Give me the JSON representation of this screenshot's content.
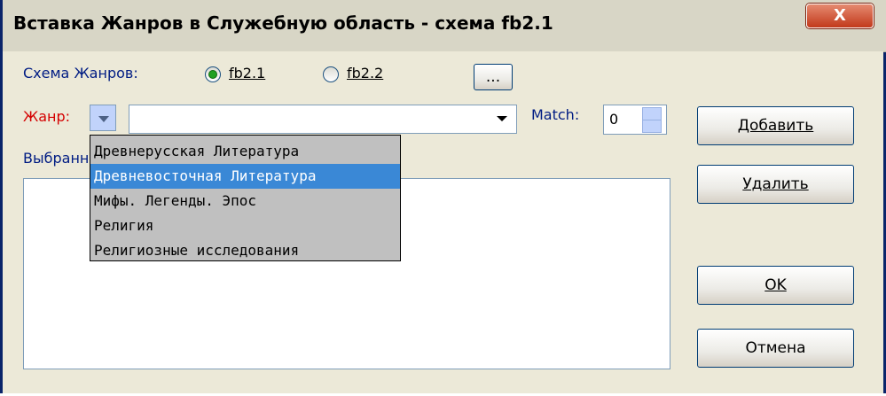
{
  "window": {
    "title": "Вставка Жанров в Служебную область - схема fb2.1",
    "close_label": "X"
  },
  "schema": {
    "label": "Схема Жанров:",
    "options": [
      {
        "label": "fb2.1",
        "checked": true
      },
      {
        "label": "fb2.2",
        "checked": false
      }
    ],
    "browse_label": "..."
  },
  "genre": {
    "label": "Жанр:",
    "value": ""
  },
  "match": {
    "label": "Match:",
    "value": "0"
  },
  "selected": {
    "label_visible": "Выбранн"
  },
  "dropdown": {
    "items": [
      "Древнерусская Литература",
      "Древневосточная Литература",
      "Мифы. Легенды. Эпос",
      "Религия",
      "Религиозные исследования"
    ],
    "selected_index": 1
  },
  "buttons": {
    "add": "Добавить",
    "remove": "Удалить",
    "ok": "OK",
    "cancel": "Отмена"
  },
  "colors": {
    "label_blue": "#001c83",
    "label_red": "#d40000",
    "selection": "#3a88d6"
  }
}
